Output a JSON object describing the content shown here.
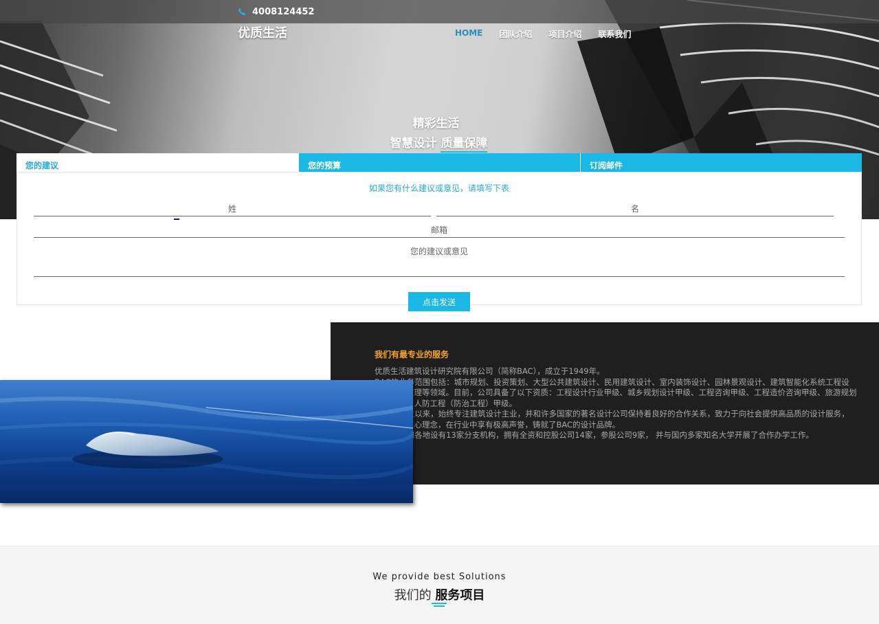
{
  "header": {
    "phone": "4008124452",
    "logo": "优质生活",
    "nav": [
      "HOME",
      "团队介绍",
      "项目介绍",
      "联系我们"
    ]
  },
  "hero": {
    "slogan_line1": "精彩生活",
    "slogan_line2_prefix": "智慧设计",
    "slogan_line2_highlight": "质量保障"
  },
  "form": {
    "tabs": [
      "您的建议",
      "您的预算",
      "订阅邮件"
    ],
    "hint": "如果您有什么建议或意见，请填写下表",
    "last_name_placeholder": "姓",
    "first_name_placeholder": "名",
    "email_placeholder": "邮箱",
    "message_placeholder": "您的建议或意见",
    "submit_label": "点击发送"
  },
  "about": {
    "title": "我们有最专业的服务",
    "paragraphs": [
      "优质生活建筑设计研究院有限公司（简称BAC），成立于1949年。",
      "BAC的业务范围包括：城市规划、投资策划、大型公共建筑设计、民用建筑设计、室内装饰设计、园林景观设计、建筑智能化系统工程设",
      "计、工程监理等领域。目前，公司具备了以下资质：工程设计行业甲级、城乡规划设计甲级、工程咨询甲级、工程造价咨询甲级、旅游规划",
      "设计甲级、人防工程（防治工程）甲级。",
      "BAC自成立以来，始终专注建筑设计主业，并和许多国家的著名设计公司保持着良好的合作关系，致力于向社会提供高品质的设计服务，",
      "以诚信为核心理念，在行业中享有极高声誉，铸就了BAC的设计品牌。",
      "BAC在全国各地设有13家分支机构，拥有全资和控股公司14家，参股公司9家， 并与国内多家知名大学开展了合作办学工作。"
    ]
  },
  "services": {
    "subtitle_en": "We provide best Solutions",
    "title_prefix": "我们的",
    "title_bold": "服务项目"
  },
  "colors": {
    "accent": "#1ab8e4",
    "about_title": "#f5a623",
    "about_bg": "#1f1f1f"
  }
}
